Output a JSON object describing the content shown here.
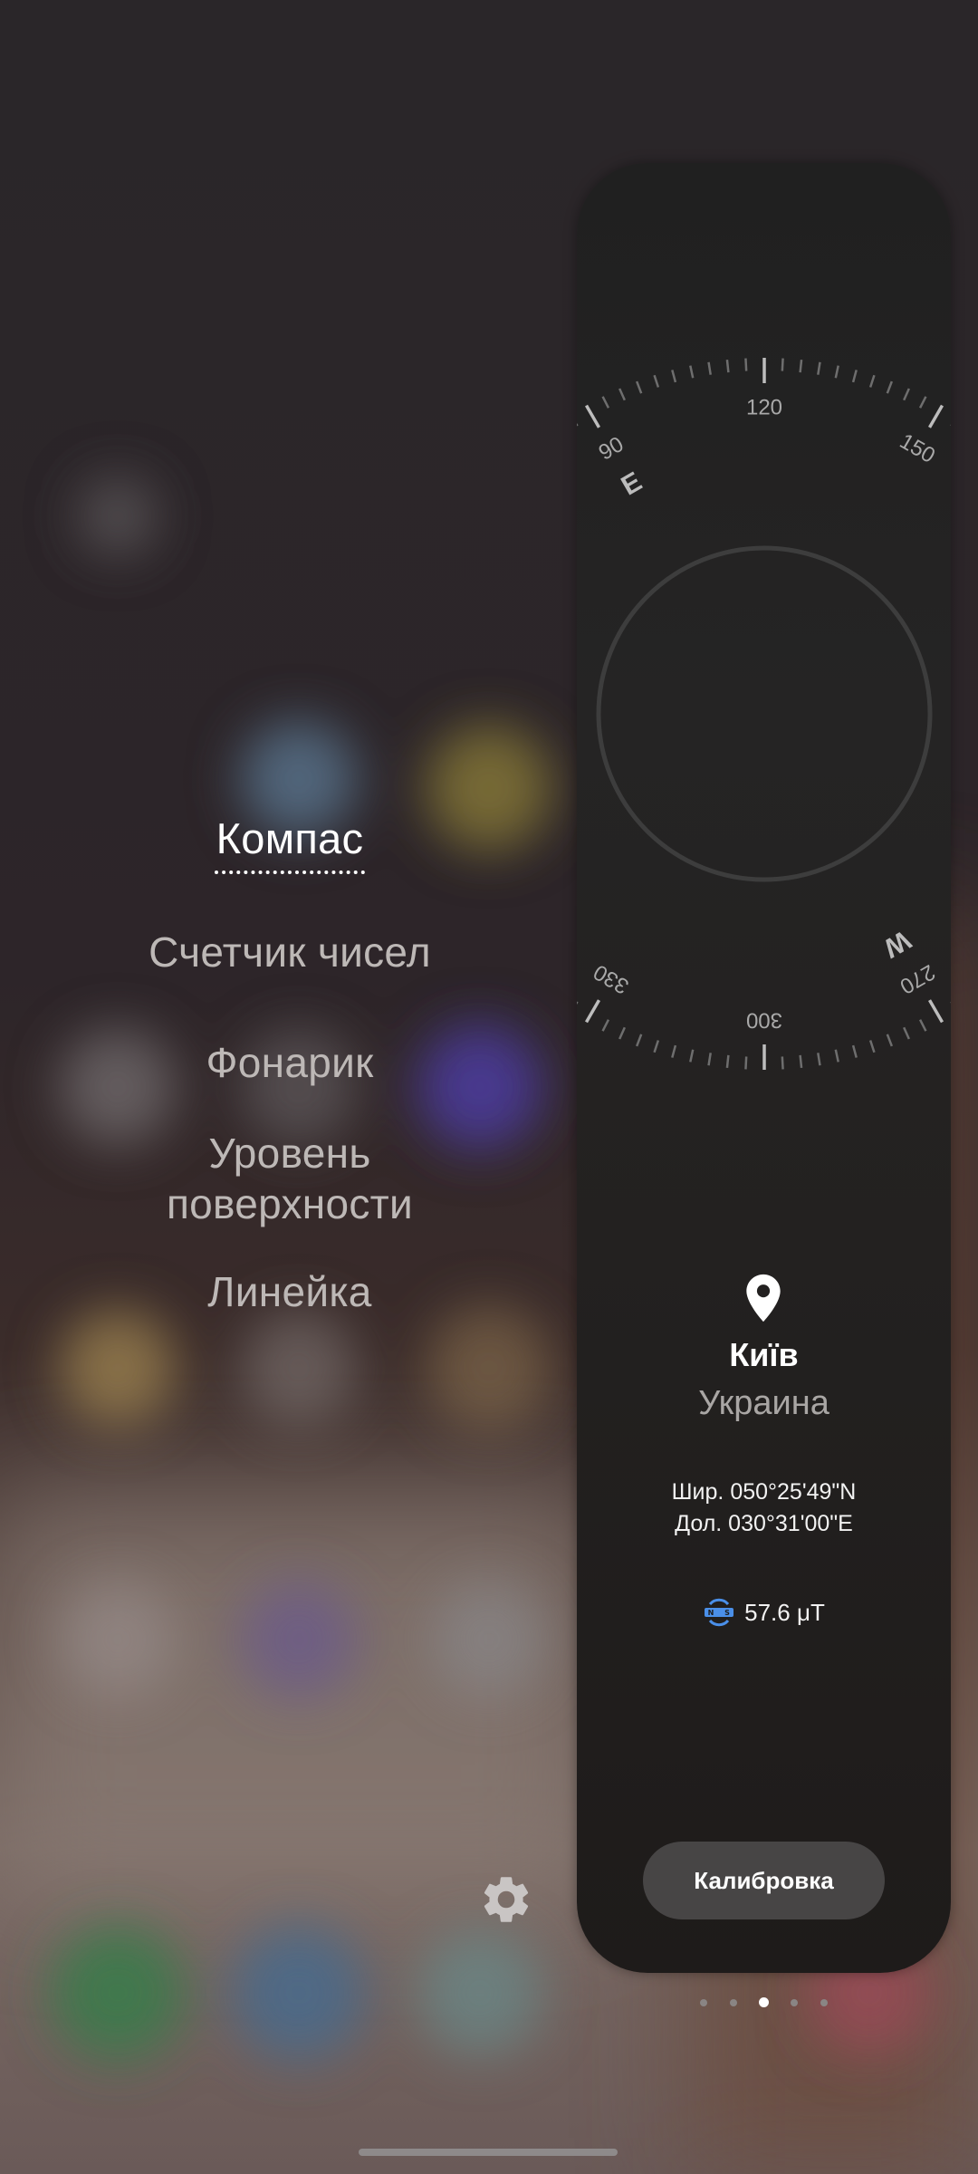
{
  "tools_menu": {
    "items": [
      {
        "label": "Компас",
        "active": true
      },
      {
        "label": "Счетчик чисел",
        "active": false
      },
      {
        "label": "Фонарик",
        "active": false
      },
      {
        "label": "Уровень поверхности",
        "active": false
      },
      {
        "label": "Линейка",
        "active": false
      }
    ]
  },
  "compass": {
    "heading_degrees": 300,
    "cardinal_labels": [
      "E",
      "W"
    ],
    "degree_labels": [
      "90",
      "120",
      "150",
      "270",
      "300",
      "330"
    ]
  },
  "location": {
    "icon": "location-pin-icon",
    "city": "Київ",
    "country": "Украина",
    "latitude": "Шир. 050°25'49\"N",
    "longitude": "Дол. 030°31'00\"E"
  },
  "magnetic_field": {
    "icon": "magnet-sensor-icon",
    "value": "57.6 μT"
  },
  "calibrate_button": {
    "label": "Калибровка"
  },
  "page_indicator": {
    "count": 5,
    "active_index": 2
  },
  "colors": {
    "accent_blue": "#4a8fe8",
    "panel_bg": "#232323",
    "button_bg": "#474545"
  },
  "icons": {
    "settings": "gear-icon"
  }
}
